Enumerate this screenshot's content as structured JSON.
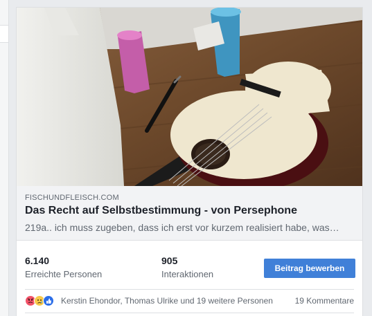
{
  "link_preview": {
    "domain": "FISCHUNDFLEISCH.COM",
    "title": "Das Recht auf Selbstbestimmung - von Persephone",
    "description": "219a.. ich muss zugeben, dass ich erst vor kurzem realisiert habe, was…"
  },
  "insights": {
    "reach_value": "6.140",
    "reach_label": "Erreichte Personen",
    "engagement_value": "905",
    "engagement_label": "Interaktionen",
    "boost_label": "Beitrag bewerben"
  },
  "reactions": {
    "icons": [
      "angry-reaction-icon",
      "sad-reaction-icon",
      "like-reaction-icon"
    ],
    "reactors_text": "Kerstin Ehondor, Thomas Ulrike und 19 weitere Personen",
    "comments_text": "19 Kommentare"
  },
  "colors": {
    "accent": "#4080d8",
    "link_box_bg": "#f2f3f5"
  }
}
